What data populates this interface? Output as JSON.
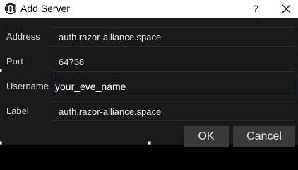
{
  "window": {
    "title": "Add Server",
    "help_glyph": "?",
    "close_icon": "close-icon",
    "app_icon": "mumble-app-icon"
  },
  "form": {
    "address": {
      "label": "Address",
      "value": "auth.razor-alliance.space"
    },
    "port": {
      "label": "Port",
      "value": "64738"
    },
    "username": {
      "label": "Username",
      "value": "your_eve_name"
    },
    "display_label": {
      "label": "Label",
      "value": "auth.razor-alliance.space"
    }
  },
  "buttons": {
    "ok": "OK",
    "cancel": "Cancel"
  },
  "colors": {
    "background": "#191919",
    "field_border": "#2c2c2c",
    "focus_border": "#3a5e85",
    "button": "#3a3a3a"
  }
}
